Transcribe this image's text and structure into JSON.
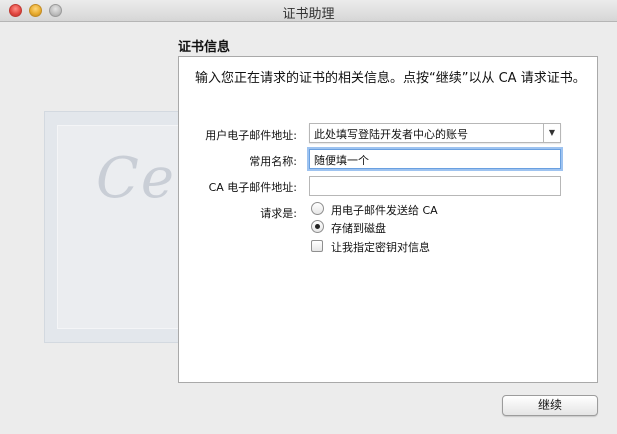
{
  "window": {
    "title": "证书助理"
  },
  "section": {
    "heading": "证书信息"
  },
  "intro": "输入您正在请求的证书的相关信息。点按“继续”以从 CA 请求证书。",
  "background_art": {
    "word": "Certificate"
  },
  "form": {
    "user_email": {
      "label": "用户电子邮件地址:",
      "value": "此处填写登陆开发者中心的账号"
    },
    "common_name": {
      "label": "常用名称:",
      "value": "随便填一个"
    },
    "ca_email": {
      "label": "CA 电子邮件地址:",
      "value": ""
    },
    "request": {
      "label": "请求是:",
      "options": [
        {
          "label": "用电子邮件发送给 CA",
          "selected": false
        },
        {
          "label": "存储到磁盘",
          "selected": true
        }
      ],
      "checkbox": {
        "label": "让我指定密钥对信息",
        "checked": false
      }
    }
  },
  "buttons": {
    "continue": "继续"
  },
  "icons": {
    "combo": "chevron-down-icon"
  }
}
